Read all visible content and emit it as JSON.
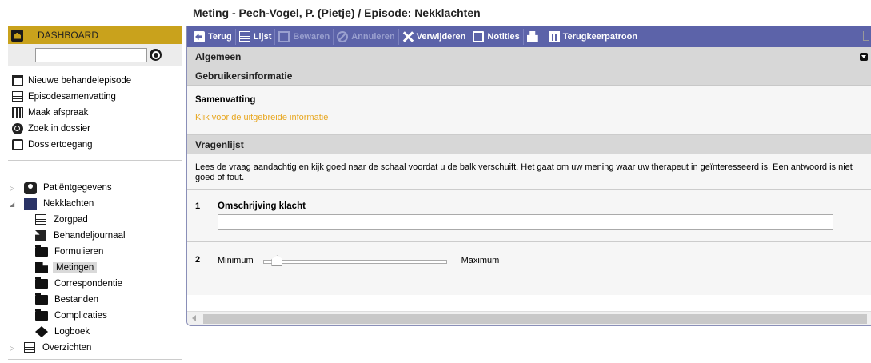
{
  "page_title": "Meting - Pech-Vogel, P. (Pietje) / Episode: Nekklachten",
  "sidebar": {
    "dashboard_label": "DASHBOARD",
    "search": {
      "value": "",
      "placeholder": ""
    },
    "actions": [
      {
        "label": "Nieuwe behandelepisode",
        "icon": "calendar-plus-icon"
      },
      {
        "label": "Episodesamenvatting",
        "icon": "list-icon"
      },
      {
        "label": "Maak afspraak",
        "icon": "calendar-grid-icon"
      },
      {
        "label": "Zoek in dossier",
        "icon": "search-icon"
      },
      {
        "label": "Dossiertoegang",
        "icon": "edit-icon"
      }
    ],
    "tree": {
      "patient": "Patiëntgegevens",
      "episode": "Nekklachten",
      "episode_items": [
        {
          "label": "Zorgpad",
          "icon": "list-icon"
        },
        {
          "label": "Behandeljournaal",
          "icon": "pen-icon"
        },
        {
          "label": "Formulieren",
          "icon": "folder-icon"
        },
        {
          "label": "Metingen",
          "icon": "measure-icon",
          "selected": true
        },
        {
          "label": "Correspondentie",
          "icon": "folder-icon"
        },
        {
          "label": "Bestanden",
          "icon": "folder-icon"
        },
        {
          "label": "Complicaties",
          "icon": "folder-icon"
        },
        {
          "label": "Logboek",
          "icon": "logbook-icon"
        }
      ],
      "overviews": "Overzichten"
    }
  },
  "toolbar": {
    "back": "Terug",
    "list": "Lijst",
    "save": "Bewaren",
    "cancel": "Annuleren",
    "delete": "Verwijderen",
    "notes": "Notities",
    "return_pattern": "Terugkeerpatroon"
  },
  "sections": {
    "general": "Algemeen",
    "user_info": "Gebruikersinformatie",
    "summary_heading": "Samenvatting",
    "more_info_link": "Klik voor de uitgebreide informatie",
    "questionnaire": "Vragenlijst"
  },
  "questionnaire": {
    "instruction": "Lees de vraag aandachtig en kijk goed naar de schaal voordat u de balk verschuift. Het gaat om uw mening waar uw therapeut in geïnteresseerd is. Een antwoord is niet goed of fout.",
    "q1": {
      "number": "1",
      "label": "Omschrijving klacht",
      "value": ""
    },
    "q2": {
      "number": "2",
      "min_label": "Minimum",
      "max_label": "Maximum",
      "value_fraction": 0.05
    }
  },
  "colors": {
    "dashboard_bg": "#c9a21c",
    "toolbar_bg": "#5c63a9",
    "link": "#e8a720"
  }
}
